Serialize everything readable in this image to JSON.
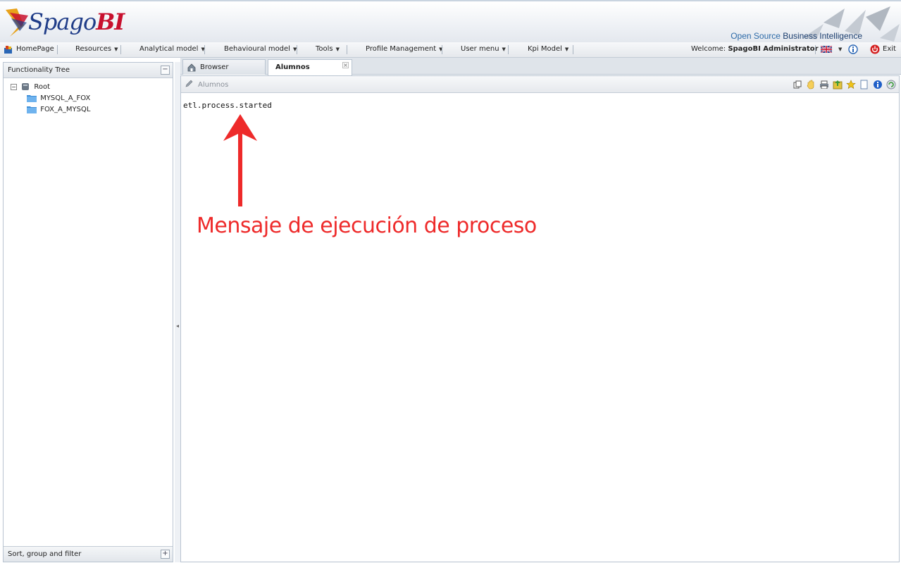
{
  "header": {
    "logo_text": "Spago",
    "logo_bi": "BI",
    "tagline_open_source": "Open Source",
    "tagline_rest": "Business Intelligence"
  },
  "menu": {
    "items": [
      {
        "label": "HomePage",
        "icon": "home-icon"
      },
      {
        "label": "Resources"
      },
      {
        "label": "Analytical model"
      },
      {
        "label": "Behavioural model"
      },
      {
        "label": "Tools"
      },
      {
        "label": "Profile Management"
      },
      {
        "label": "User menu"
      },
      {
        "label": "Kpi Model"
      }
    ],
    "welcome_prefix": "Welcome:",
    "welcome_user": "SpagoBI Administrator",
    "exit_label": "Exit"
  },
  "left_panel": {
    "title": "Functionality Tree",
    "tree": {
      "root": "Root",
      "children": [
        "MYSQL_A_FOX",
        "FOX_A_MYSQL"
      ]
    },
    "sort_title": "Sort, group and filter"
  },
  "tabs": [
    {
      "label": "Browser",
      "active": false
    },
    {
      "label": "Alumnos",
      "active": true
    }
  ],
  "document": {
    "title": "Alumnos",
    "output": "etl.process.started"
  },
  "annotation": {
    "text": "Mensaje de ejecución de proceso",
    "color": "#ee2a2a"
  }
}
